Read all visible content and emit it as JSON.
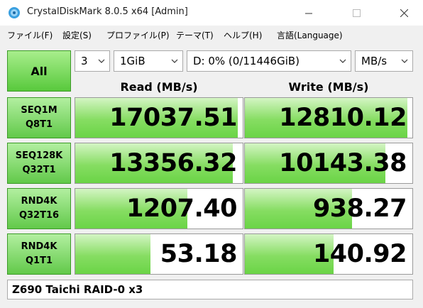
{
  "window": {
    "title": "CrystalDiskMark 8.0.5 x64 [Admin]"
  },
  "menu": [
    {
      "label": "ファイル(F)"
    },
    {
      "label": "設定(S)"
    },
    {
      "label": "プロファイル(P)"
    },
    {
      "label": "テーマ(T)"
    },
    {
      "label": "ヘルプ(H)"
    },
    {
      "label": "言語(Language)"
    }
  ],
  "controls": {
    "all_label": "All",
    "count": "3",
    "size": "1GiB",
    "drive": "D: 0% (0/11446GiB)",
    "unit": "MB/s"
  },
  "headers": {
    "read": "Read (MB/s)",
    "write": "Write (MB/s)"
  },
  "tests": [
    {
      "line1": "SEQ1M",
      "line2": "Q8T1",
      "read": "17037.51",
      "write": "12810.12",
      "read_fill": 0.97,
      "write_fill": 0.97
    },
    {
      "line1": "SEQ128K",
      "line2": "Q32T1",
      "read": "13356.32",
      "write": "10143.38",
      "read_fill": 0.94,
      "write_fill": 0.84
    },
    {
      "line1": "RND4K",
      "line2": "Q32T16",
      "read": "1207.40",
      "write": "938.27",
      "read_fill": 0.67,
      "write_fill": 0.64
    },
    {
      "line1": "RND4K",
      "line2": "Q1T1",
      "read": "53.18",
      "write": "140.92",
      "read_fill": 0.45,
      "write_fill": 0.53
    }
  ],
  "comment": "Z690 Taichi RAID-0 x3",
  "colors": {
    "accent_green": "#6ad446",
    "label_green": "#62c94a"
  }
}
